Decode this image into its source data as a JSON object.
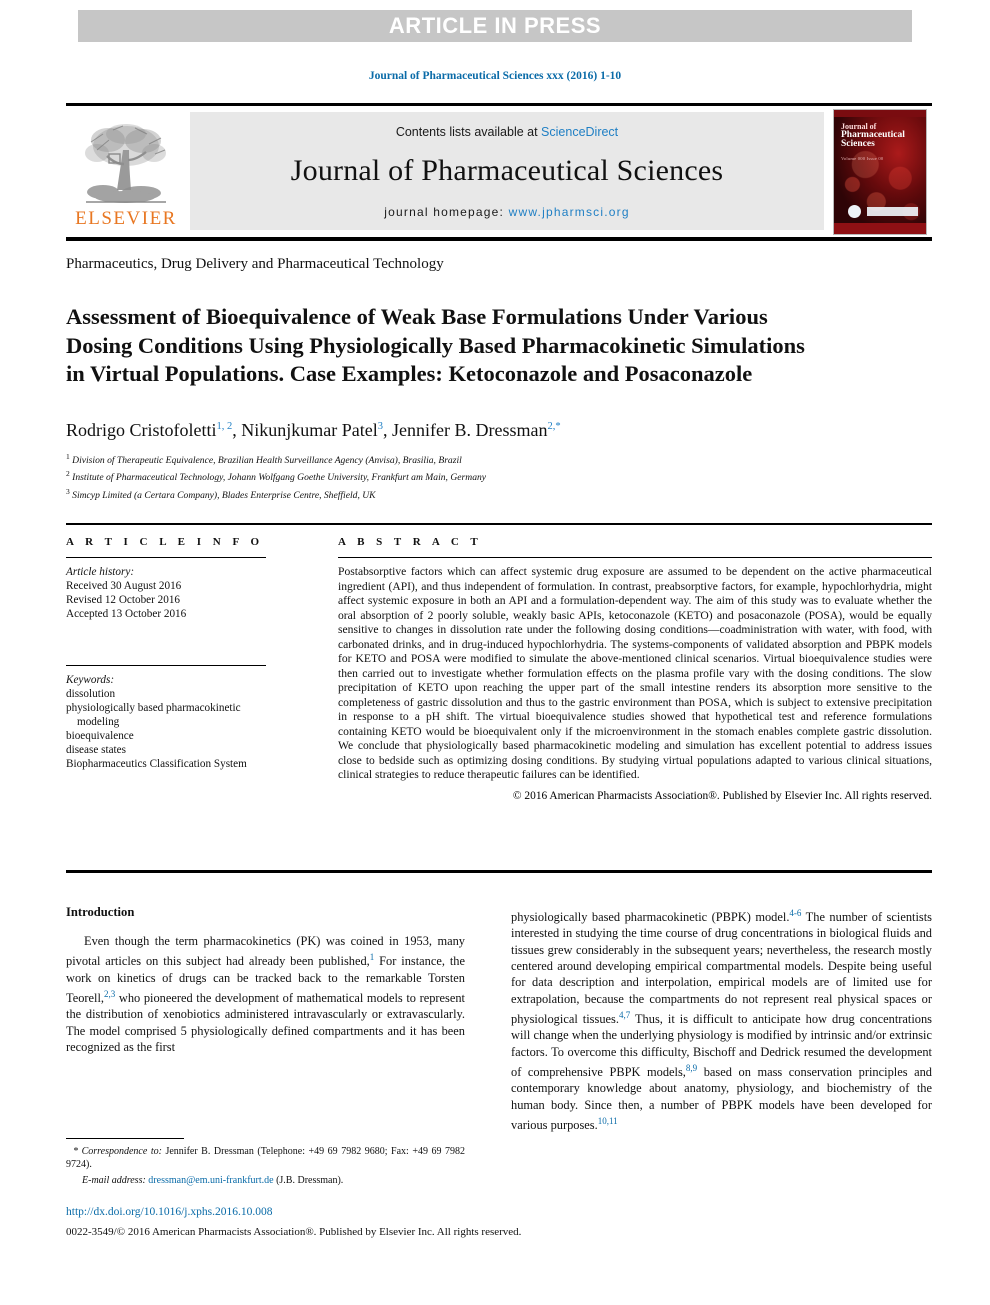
{
  "banner": {
    "text": "ARTICLE IN PRESS"
  },
  "running_head": "Journal of Pharmaceutical Sciences xxx (2016) 1-10",
  "masthead": {
    "publisher": "ELSEVIER",
    "contents_prefix": "Contents lists available at ",
    "contents_link": "ScienceDirect",
    "journal_title": "Journal of Pharmaceutical Sciences",
    "homepage_prefix": "journal homepage: ",
    "homepage_url": "www.jpharmsci.org",
    "cover": {
      "line1": "Journal of",
      "line2": "Pharmaceutical",
      "line3": "Sciences",
      "sub": "Volume 000  Issue 00"
    }
  },
  "section_label": "Pharmaceutics, Drug Delivery and Pharmaceutical Technology",
  "title": "Assessment of Bioequivalence of Weak Base Formulations Under Various Dosing Conditions Using Physiologically Based Pharmacokinetic Simulations in Virtual Populations. Case Examples: Ketoconazole and Posaconazole",
  "authors": {
    "a1_name": "Rodrigo Cristofoletti",
    "a1_sup": "1, 2",
    "sep1": ", ",
    "a2_name": "Nikunjkumar Patel",
    "a2_sup": "3",
    "sep2": ", ",
    "a3_name": "Jennifer B. Dressman",
    "a3_sup": "2,",
    "a3_star": "*"
  },
  "affiliations": [
    {
      "num": "1",
      "text": "Division of Therapeutic Equivalence, Brazilian Health Surveillance Agency (Anvisa), Brasilia, Brazil"
    },
    {
      "num": "2",
      "text": "Institute of Pharmaceutical Technology, Johann Wolfgang Goethe University, Frankfurt am Main, Germany"
    },
    {
      "num": "3",
      "text": "Simcyp Limited (a Certara Company), Blades Enterprise Centre, Sheffield, UK"
    }
  ],
  "article_info": {
    "heading": "A R T I C L E  I N F O",
    "history_label": "Article history:",
    "history": [
      "Received 30 August 2016",
      "Revised 12 October 2016",
      "Accepted 13 October 2016"
    ],
    "keywords_label": "Keywords:",
    "keywords": [
      "dissolution",
      "physiologically based pharmacokinetic",
      "modeling",
      "bioequivalence",
      "disease states",
      "Biopharmaceutics Classification System"
    ]
  },
  "abstract": {
    "heading": "A B S T R A C T",
    "text": "Postabsorptive factors which can affect systemic drug exposure are assumed to be dependent on the active pharmaceutical ingredient (API), and thus independent of formulation. In contrast, preabsorptive factors, for example, hypochlorhydria, might affect systemic exposure in both an API and a formulation-dependent way. The aim of this study was to evaluate whether the oral absorption of 2 poorly soluble, weakly basic APIs, ketoconazole (KETO) and posaconazole (POSA), would be equally sensitive to changes in dissolution rate under the following dosing conditions—coadministration with water, with food, with carbonated drinks, and in drug-induced hypochlorhydria. The systems-components of validated absorption and PBPK models for KETO and POSA were modified to simulate the above-mentioned clinical scenarios. Virtual bioequivalence studies were then carried out to investigate whether formulation effects on the plasma profile vary with the dosing conditions. The slow precipitation of KETO upon reaching the upper part of the small intestine renders its absorption more sensitive to the completeness of gastric dissolution and thus to the gastric environment than POSA, which is subject to extensive precipitation in response to a pH shift. The virtual bioequivalence studies showed that hypothetical test and reference formulations containing KETO would be bioequivalent only if the microenvironment in the stomach enables complete gastric dissolution. We conclude that physiologically based pharmacokinetic modeling and simulation has excellent potential to address issues close to bedside such as optimizing dosing conditions. By studying virtual populations adapted to various clinical situations, clinical strategies to reduce therapeutic failures can be identified.",
    "copyright": "© 2016 American Pharmacists Association®. Published by Elsevier Inc. All rights reserved."
  },
  "introduction": {
    "heading": "Introduction",
    "left_para_1": "Even though the term pharmacokinetics (PK) was coined in 1953, many pivotal articles on this subject had already been published,",
    "left_ref_1": "1",
    "left_para_1b": " For instance, the work on kinetics of drugs can be tracked back to the remarkable Torsten Teorell,",
    "left_ref_2": "2,3",
    "left_para_1c": " who pioneered the development of mathematical models to represent the distribution of xenobiotics administered intravascularly or extravascularly. The model comprised 5 physiologically defined compartments and it has been recognized as the first",
    "right_para_a": "physiologically based pharmacokinetic (PBPK) model.",
    "right_ref_a": "4-6",
    "right_para_b": " The number of scientists interested in studying the time course of drug concentrations in biological fluids and tissues grew considerably in the subsequent years; nevertheless, the research mostly centered around developing empirical compartmental models. Despite being useful for data description and interpolation, empirical models are of limited use for extrapolation, because the compartments do not represent real physical spaces or physiological tissues.",
    "right_ref_b": "4,7",
    "right_para_c": " Thus, it is difficult to anticipate how drug concentrations will change when the underlying physiology is modified by intrinsic and/or extrinsic factors. To overcome this difficulty, Bischoff and Dedrick resumed the development of comprehensive PBPK models,",
    "right_ref_c": "8,9",
    "right_para_d": " based on mass conservation principles and contemporary knowledge about anatomy, physiology, and biochemistry of the human body. Since then, a number of PBPK models have been developed for various purposes.",
    "right_ref_d": "10,11"
  },
  "footnote": {
    "star": "*",
    "corr_label": "Correspondence to:",
    "corr_text": " Jennifer B. Dressman (Telephone: +49 69 7982 9680; Fax: +49 69 7982 9724).",
    "email_label": "E-mail address:",
    "email_link": "dressman@em.uni-frankfurt.de",
    "email_suffix": " (J.B. Dressman)."
  },
  "doi": "http://dx.doi.org/10.1016/j.xphs.2016.10.008",
  "issn": "0022-3549/© 2016 American Pharmacists Association®. Published by Elsevier Inc. All rights reserved.",
  "colors": {
    "link": "#0a6ba8",
    "elsevier_orange": "#e87722",
    "banner_bg": "#c6c6c6",
    "masthead_bg": "#e8e8e8"
  }
}
